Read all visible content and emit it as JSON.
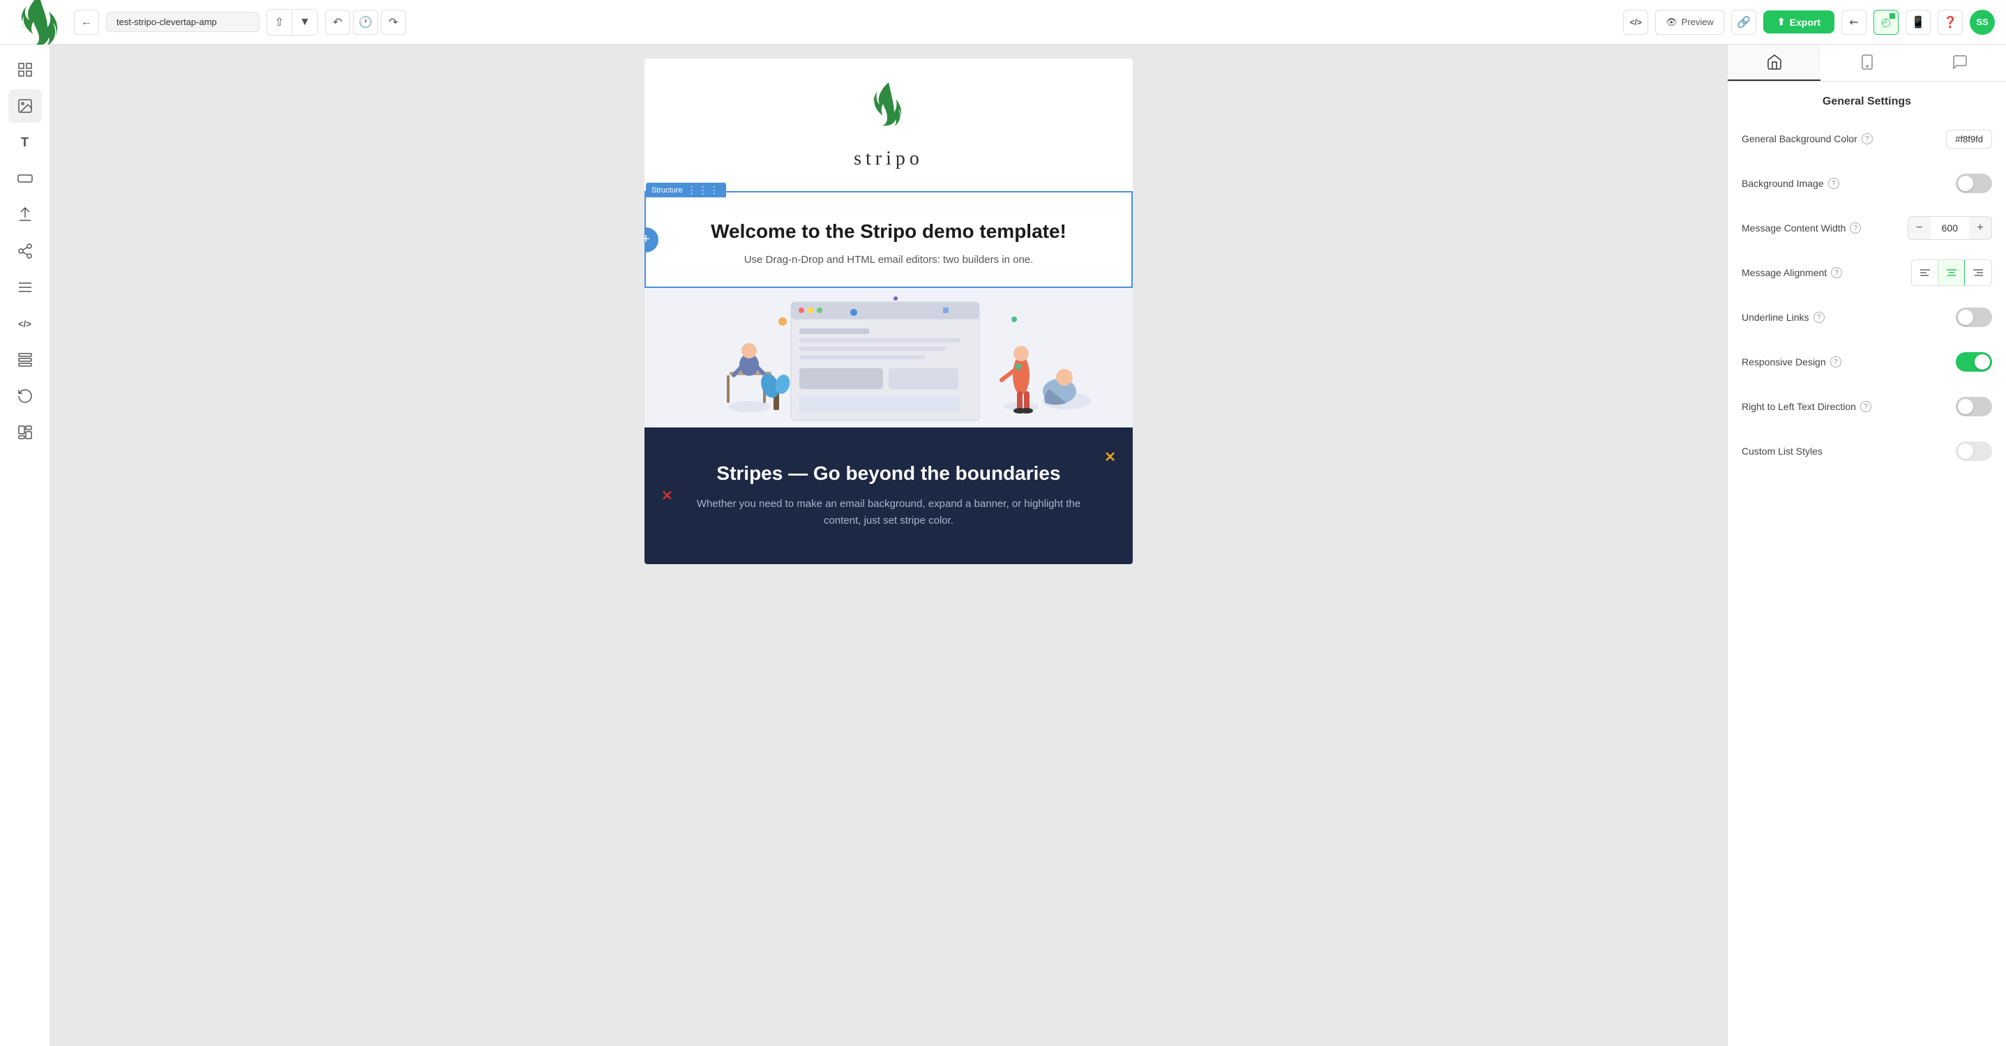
{
  "topbar": {
    "url": "test-stripo-clevertap-amp",
    "export_label": "Export",
    "preview_label": "Preview",
    "device_desktop_label": "Desktop view",
    "device_mobile_label": "Mobile view"
  },
  "sidebar": {
    "items": [
      {
        "id": "grid",
        "icon": "⊞",
        "label": "Blocks"
      },
      {
        "id": "image",
        "icon": "🖼",
        "label": "Images"
      },
      {
        "id": "text",
        "icon": "T",
        "label": "Text"
      },
      {
        "id": "banner",
        "icon": "▬",
        "label": "Banner"
      },
      {
        "id": "social",
        "icon": "⬆",
        "label": "Social"
      },
      {
        "id": "share",
        "icon": "⬡",
        "label": "Share"
      },
      {
        "id": "menu",
        "icon": "☰",
        "label": "Menu"
      },
      {
        "id": "code",
        "icon": "</>",
        "label": "Code"
      },
      {
        "id": "template",
        "icon": "🏛",
        "label": "Template"
      },
      {
        "id": "undo",
        "icon": "↺",
        "label": "Undo"
      },
      {
        "id": "module",
        "icon": "⊟",
        "label": "Modules"
      }
    ]
  },
  "canvas": {
    "structure_label": "Structure",
    "welcome_title": "Welcome to the Stripo demo template!",
    "welcome_subtitle": "Use Drag-n-Drop and HTML email editors: two builders in one.",
    "dark_title": "Stripes — Go beyond the boundaries",
    "dark_subtitle": "Whether you need to make an email background, expand a banner, or highlight the content, just set stripe color."
  },
  "right_panel": {
    "title": "General Settings",
    "tabs": [
      {
        "id": "settings",
        "icon": "⌂",
        "label": "Settings"
      },
      {
        "id": "mobile",
        "icon": "📱",
        "label": "Mobile"
      },
      {
        "id": "comments",
        "icon": "💬",
        "label": "Comments"
      }
    ],
    "settings": [
      {
        "id": "general-bg-color",
        "label": "General Background Color",
        "type": "color",
        "value": "#f8f9fd"
      },
      {
        "id": "background-image",
        "label": "Background Image",
        "type": "toggle",
        "value": false
      },
      {
        "id": "message-content-width",
        "label": "Message Content Width",
        "type": "number",
        "value": 600
      },
      {
        "id": "message-alignment",
        "label": "Message Alignment",
        "type": "alignment",
        "value": "center",
        "options": [
          "left",
          "center",
          "right"
        ]
      },
      {
        "id": "underline-links",
        "label": "Underline Links",
        "type": "toggle",
        "value": false
      },
      {
        "id": "responsive-design",
        "label": "Responsive Design",
        "type": "toggle",
        "value": true
      },
      {
        "id": "rtl-text",
        "label": "Right to Left Text Direction",
        "type": "toggle",
        "value": false
      },
      {
        "id": "custom-list-styles",
        "label": "Custom List Styles",
        "type": "toggle",
        "value": false
      }
    ]
  }
}
